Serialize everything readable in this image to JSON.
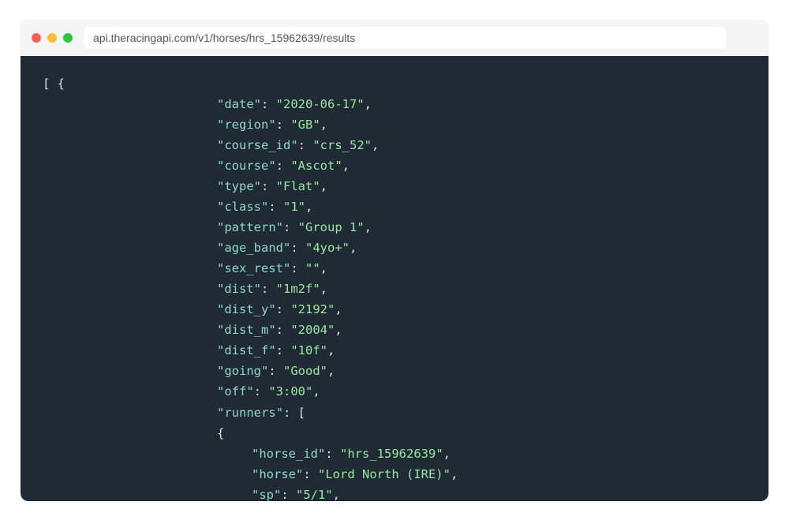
{
  "address_bar": "api.theracingapi.com/v1/horses/hrs_15962639/results",
  "colors": {
    "red": "#ff5f57",
    "yellow": "#febc2e",
    "green": "#28c840",
    "panel_bg": "#1f2a34",
    "key": "#8fd9c4",
    "string": "#97e7a0"
  },
  "code": {
    "start": "[ {",
    "keys": {
      "date": "\"date\"",
      "region": "\"region\"",
      "course_id": "\"course_id\"",
      "course": "\"course\"",
      "type": "\"type\"",
      "class": "\"class\"",
      "pattern": "\"pattern\"",
      "age_band": "\"age_band\"",
      "sex_rest": "\"sex_rest\"",
      "dist": "\"dist\"",
      "dist_y": "\"dist_y\"",
      "dist_m": "\"dist_m\"",
      "dist_f": "\"dist_f\"",
      "going": "\"going\"",
      "off": "\"off\"",
      "runners": "\"runners\"",
      "horse_id": "\"horse_id\"",
      "horse": "\"horse\"",
      "sp": "\"sp\""
    },
    "values": {
      "date": "\"2020-06-17\"",
      "region": "\"GB\"",
      "course_id": "\"crs_52\"",
      "course": "\"Ascot\"",
      "type": "\"Flat\"",
      "class": "\"1\"",
      "pattern": "\"Group 1\"",
      "age_band": "\"4yo+\"",
      "sex_rest": "\"\"",
      "dist": "\"1m2f\"",
      "dist_y": "\"2192\"",
      "dist_m": "\"2004\"",
      "dist_f": "\"10f\"",
      "going": "\"Good\"",
      "off": "\"3:00\"",
      "horse_id": "\"hrs_15962639\"",
      "horse": "\"Lord North (IRE)\"",
      "sp": "\"5/1\""
    },
    "punct": {
      "colon": ": ",
      "comma": ",",
      "open_arr": "[",
      "open_obj": "{"
    }
  }
}
